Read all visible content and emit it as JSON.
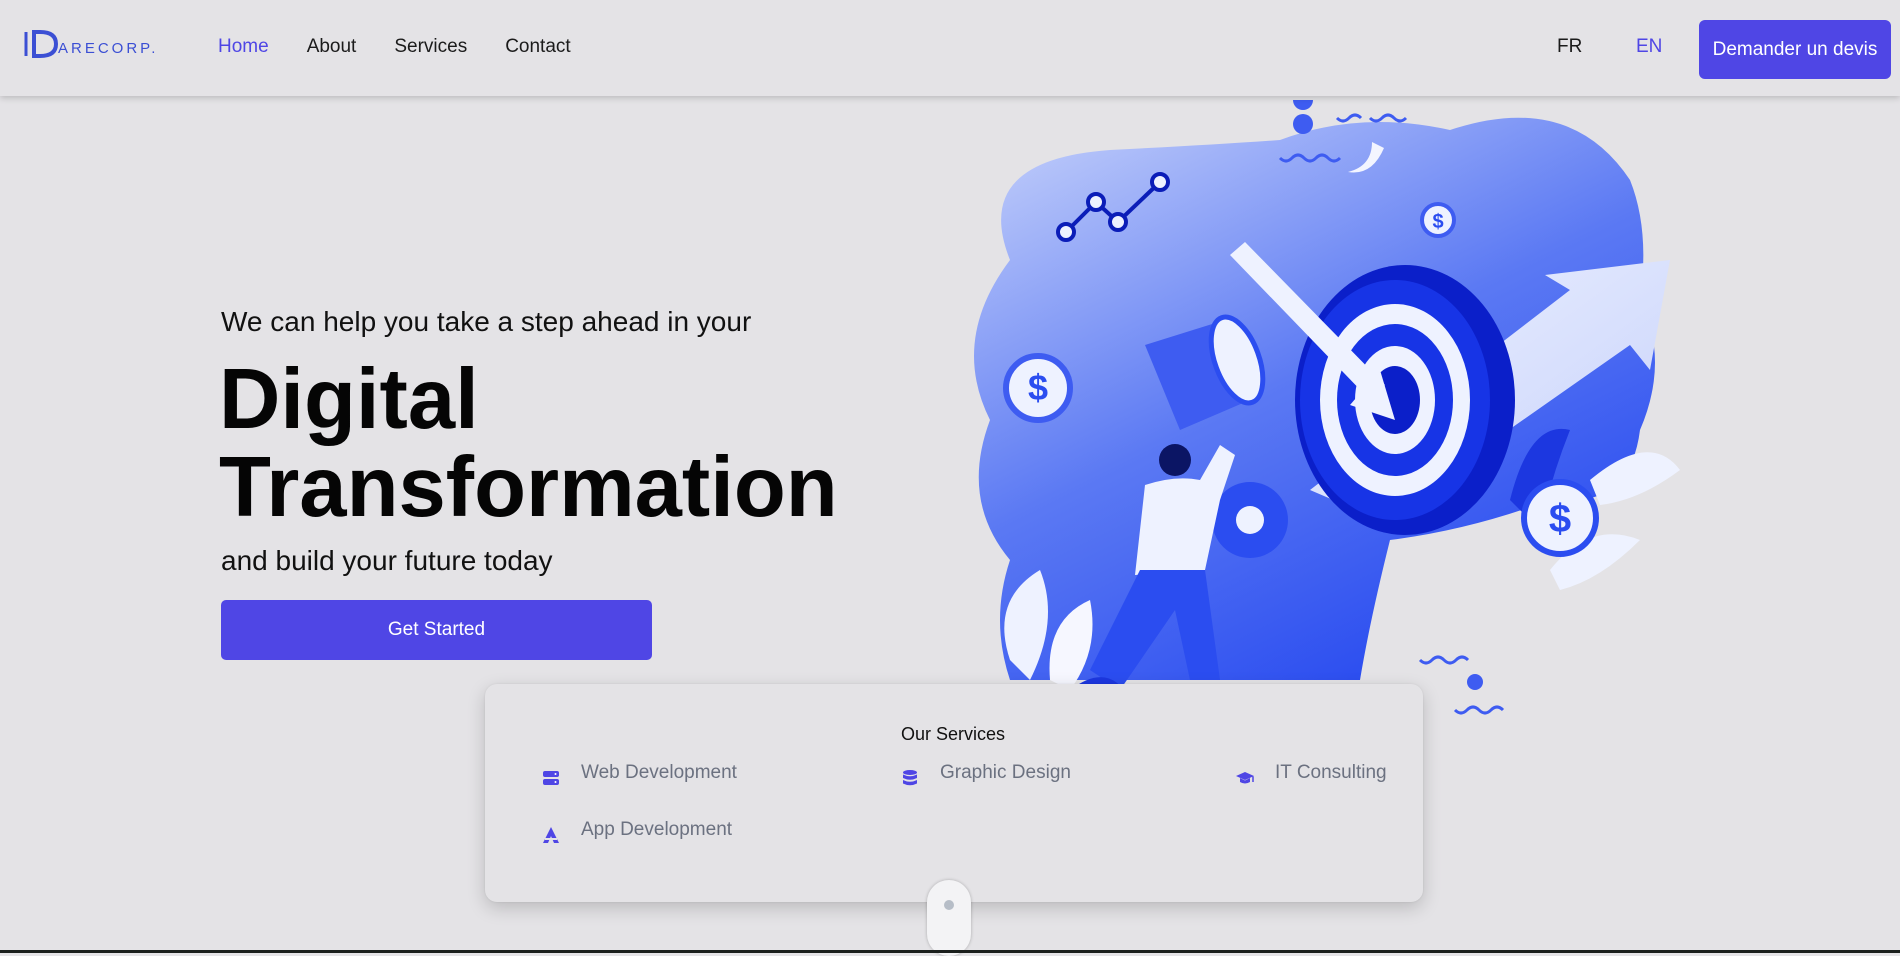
{
  "brand": {
    "logo_text": "ARECORP.",
    "logo_watermark": "CORP"
  },
  "nav": {
    "home": "Home",
    "about": "About",
    "services": "Services",
    "contact": "Contact"
  },
  "lang": {
    "fr": "FR",
    "en": "EN"
  },
  "header_cta": "Demander un devis",
  "hero": {
    "pre": "We can help you take a step ahead in your",
    "title_line1": "Digital",
    "title_line2": "Transformation",
    "post": "and build your future today",
    "cta": "Get Started"
  },
  "services": {
    "title": "Our Services",
    "items": [
      {
        "label": "Web Development",
        "icon": "server-icon"
      },
      {
        "label": "Graphic Design",
        "icon": "database-icon"
      },
      {
        "label": "IT Consulting",
        "icon": "graduation-cap-icon"
      },
      {
        "label": "App Development",
        "icon": "app-store-icon"
      }
    ]
  },
  "colors": {
    "accent": "#4f46e5",
    "background": "#e4e3e6",
    "illustration_blue": "#2f55f0"
  }
}
